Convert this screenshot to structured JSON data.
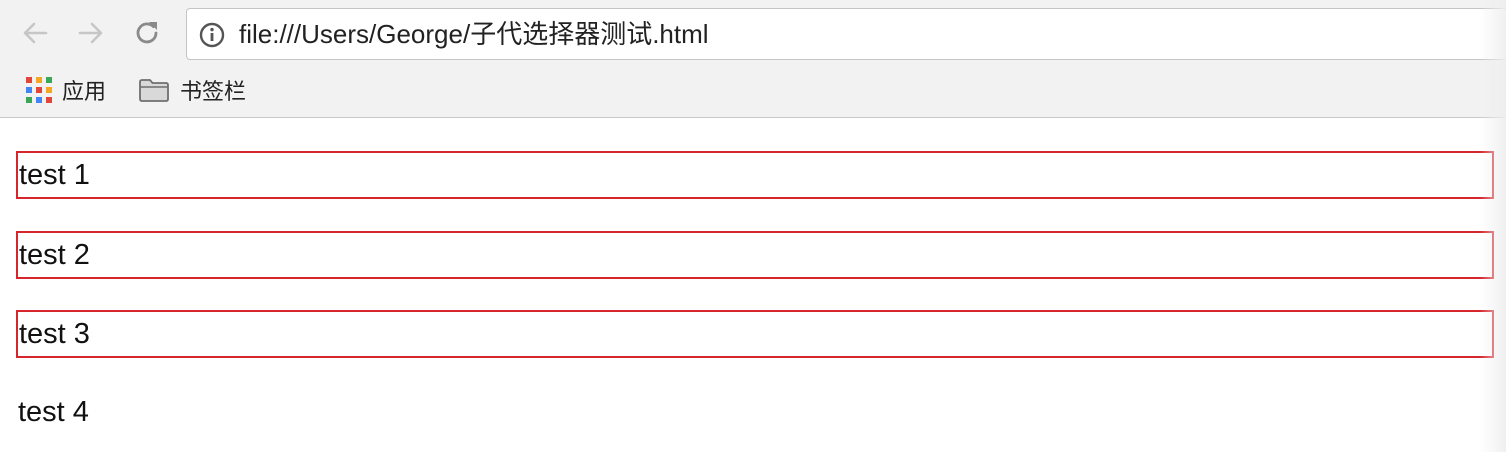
{
  "browser": {
    "nav": {
      "back_icon": "arrow-left-icon",
      "forward_icon": "arrow-right-icon",
      "reload_icon": "reload-icon"
    },
    "address_bar": {
      "icon": "info-icon",
      "url": "file:///Users/George/子代选择器测试.html"
    },
    "bookmarks_bar": {
      "items": [
        {
          "label": "应用",
          "icon": "apps-grid-icon"
        },
        {
          "label": "书签栏",
          "icon": "folder-icon"
        }
      ]
    }
  },
  "page": {
    "items": [
      {
        "text": "test 1",
        "bordered": true
      },
      {
        "text": "test 2",
        "bordered": true
      },
      {
        "text": "test 3",
        "bordered": true
      },
      {
        "text": "test 4",
        "bordered": false
      }
    ],
    "border_color": "#d6262c"
  }
}
